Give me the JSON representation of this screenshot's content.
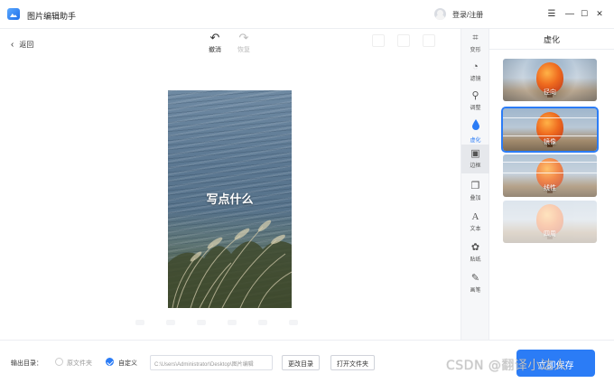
{
  "app": {
    "title": "图片编辑助手",
    "login": "登录/注册"
  },
  "window": {
    "minimize": "—",
    "maximize": "☐",
    "close": "✕",
    "menu": "☰"
  },
  "toolbar": {
    "back": "返回",
    "undo": "撤消",
    "redo": "恢复"
  },
  "canvas": {
    "overlay_text": "写点什么"
  },
  "tools": [
    {
      "label": "变形",
      "icon": "crop-icon",
      "glyph": "⌗"
    },
    {
      "label": "滤镜",
      "icon": "filter-icon",
      "glyph": "◔"
    },
    {
      "label": "调整",
      "icon": "adjust-icon",
      "glyph": "⚲"
    },
    {
      "label": "虚化",
      "icon": "blur-drop-icon",
      "glyph": "💧"
    },
    {
      "label": "边框",
      "icon": "frame-icon",
      "glyph": "▣"
    },
    {
      "label": "叠加",
      "icon": "overlay-icon",
      "glyph": "❐"
    },
    {
      "label": "文本",
      "icon": "text-icon",
      "glyph": "A"
    },
    {
      "label": "贴纸",
      "icon": "sticker-icon",
      "glyph": "✿"
    },
    {
      "label": "画笔",
      "icon": "brush-icon",
      "glyph": "✎"
    }
  ],
  "effects": {
    "title": "虚化",
    "items": [
      {
        "label": "径向",
        "selected": false
      },
      {
        "label": "镜像",
        "selected": true
      },
      {
        "label": "线性",
        "selected": false
      },
      {
        "label": "四周",
        "selected": false
      }
    ]
  },
  "footer": {
    "output_label": "输出目录：",
    "option_source": "原文件夹",
    "option_custom": "自定义",
    "path": "C:\\Users\\Administrator\\Desktop\\图片编辑",
    "change_dir": "更改目录",
    "open_folder": "打开文件夹",
    "export": "立即保存"
  },
  "watermark": "CSDN @翻译小达人",
  "colors": {
    "accent": "#2b7cf6",
    "rail_bg": "#f6f7f9"
  }
}
